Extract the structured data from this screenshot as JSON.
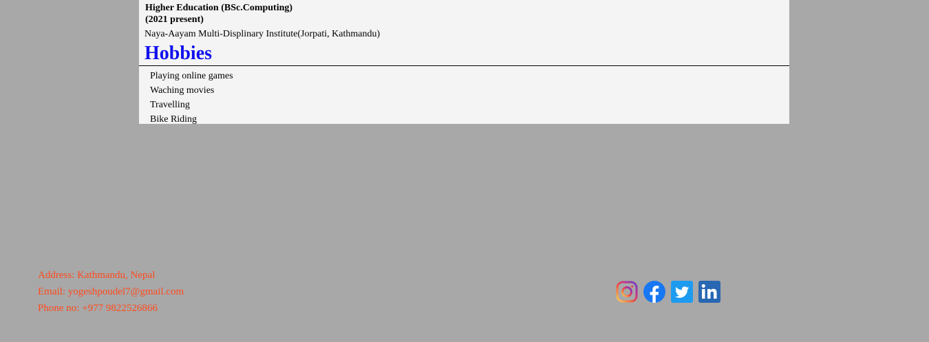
{
  "education": {
    "title": "Higher Education (BSc.Computing)",
    "years": "(2021 present)",
    "institute": "Naya-Aayam Multi-Displinary Institute(Jorpati, Kathmandu)"
  },
  "hobbies": {
    "heading": "Hobbies",
    "items": [
      "Playing online games",
      "Waching movies",
      "Travelling",
      "Bike Riding"
    ]
  },
  "footer": {
    "address": "Address: Kathmandu, Nepal",
    "email": "Email: yogeshpoudel7@gmail.com",
    "phone": "Phone no: +977 9822526866",
    "social_icons": [
      "instagram-icon",
      "facebook-icon",
      "twitter-icon",
      "linkedin-icon"
    ]
  },
  "colors": {
    "background": "#a8a8a8",
    "card": "#f4f4f4",
    "heading": "#1010ee",
    "footer_text": "#ff4a1c"
  }
}
